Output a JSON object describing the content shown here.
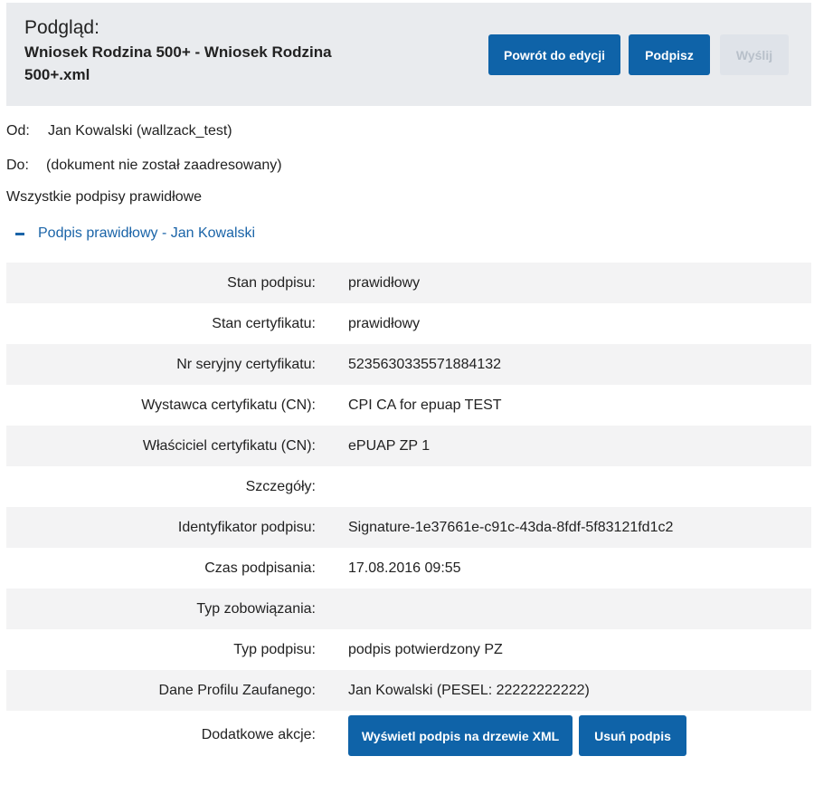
{
  "header": {
    "preview_label": "Podgląd:",
    "document_title": "Wniosek Rodzina 500+ - Wniosek Rodzina 500+.xml",
    "buttons": {
      "back_to_edit": "Powrót do edycji",
      "sign": "Podpisz",
      "send": "Wyślij"
    }
  },
  "meta": {
    "from_label": "Od:",
    "from_value": "Jan Kowalski (wallzack_test)",
    "to_label": "Do:",
    "to_value": "(dokument nie został zaadresowany)",
    "signatures_status": "Wszystkie podpisy prawidłowe"
  },
  "signature_toggle": "Podpis prawidłowy - Jan Kowalski",
  "details": [
    {
      "label": "Stan podpisu:",
      "value": "prawidłowy"
    },
    {
      "label": "Stan certyfikatu:",
      "value": "prawidłowy"
    },
    {
      "label": "Nr seryjny certyfikatu:",
      "value": "5235630335571884132"
    },
    {
      "label": "Wystawca certyfikatu (CN):",
      "value": "CPI CA for epuap TEST"
    },
    {
      "label": "Właściciel certyfikatu (CN):",
      "value": "ePUAP ZP 1"
    },
    {
      "label": "Szczegóły:",
      "value": ""
    },
    {
      "label": "Identyfikator podpisu:",
      "value": "Signature-1e37661e-c91c-43da-8fdf-5f83121fd1c2"
    },
    {
      "label": "Czas podpisania:",
      "value": "17.08.2016 09:55"
    },
    {
      "label": "Typ zobowiązania:",
      "value": ""
    },
    {
      "label": "Typ podpisu:",
      "value": "podpis potwierdzony PZ"
    },
    {
      "label": "Dane Profilu Zaufanego:",
      "value": "Jan Kowalski (PESEL: 22222222222)"
    }
  ],
  "actions": {
    "label": "Dodatkowe akcje:",
    "show_xml_tree": "Wyświetl podpis na drzewie XML",
    "remove_signature": "Usuń podpis"
  },
  "colors": {
    "primary": "#0f63a8",
    "header_bg": "#e9ebee",
    "link": "#1a64a8",
    "disabled_bg": "#dfe3e9"
  }
}
